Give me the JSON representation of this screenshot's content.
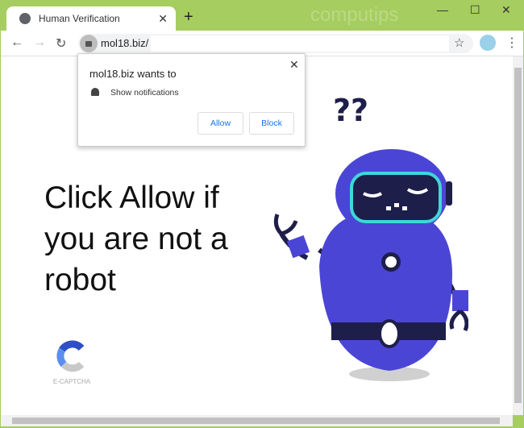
{
  "tab": {
    "title": "Human Verification",
    "close": "✕",
    "new_tab": "+"
  },
  "watermark": "computips",
  "window": {
    "minimize": "—",
    "maximize": "☐",
    "close": "✕"
  },
  "toolbar": {
    "back": "←",
    "forward": "→",
    "reload": "↻",
    "url": "mol18.biz/",
    "star": "☆",
    "menu": "⋮"
  },
  "popup": {
    "title": "mol18.biz wants to",
    "permission": "Show notifications",
    "allow": "Allow",
    "block": "Block",
    "close": "✕"
  },
  "page": {
    "headline": "Click Allow if you are not a robot",
    "logo_text": "E-CAPTCHA"
  },
  "colors": {
    "frame": "#a6cd5f",
    "robot_body": "#4b45d6",
    "accent_blue": "#1a73e8"
  }
}
